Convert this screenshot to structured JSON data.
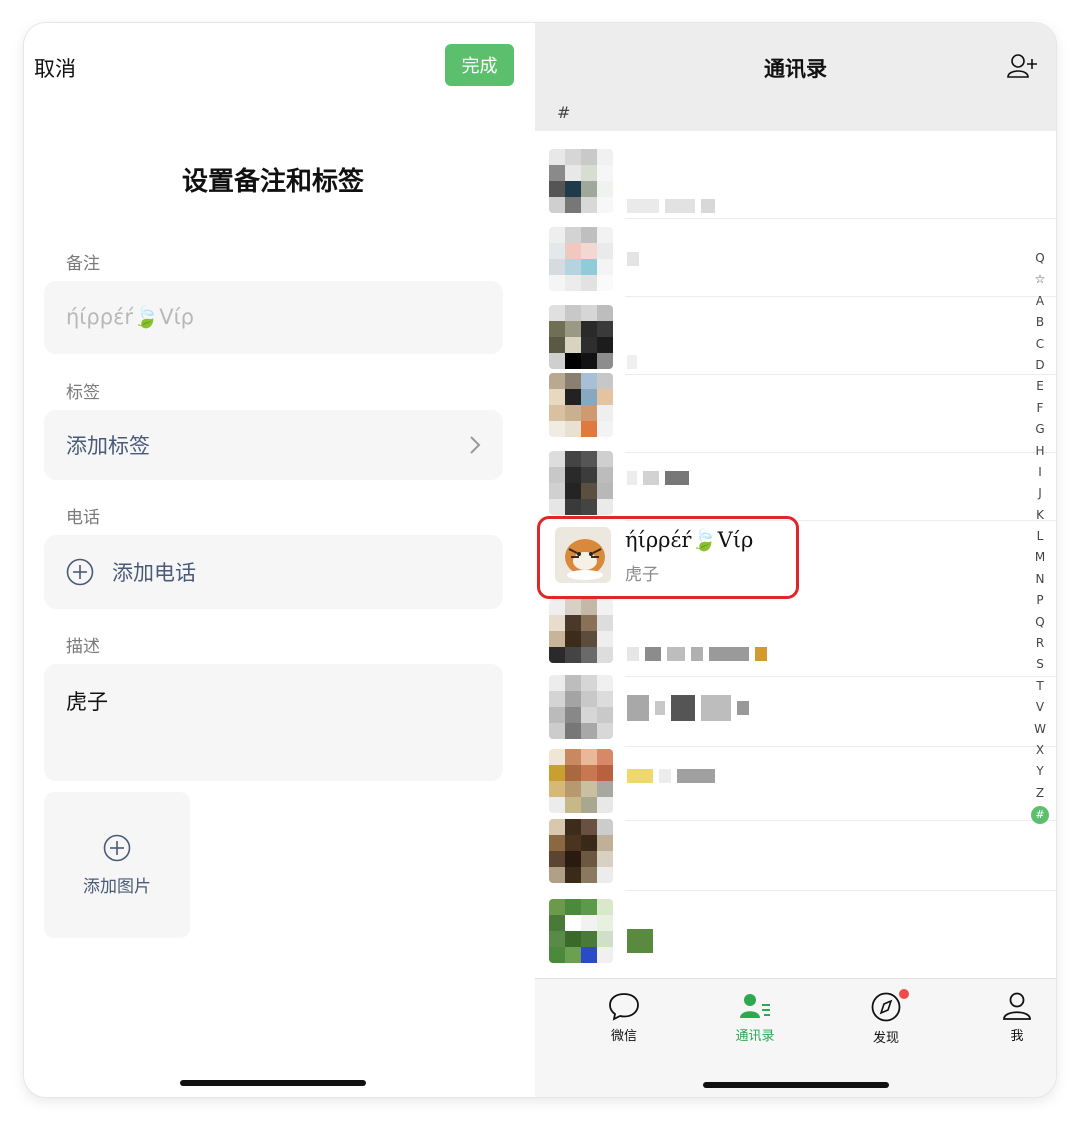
{
  "left": {
    "cancel_label": "取消",
    "done_label": "完成",
    "title": "设置备注和标签",
    "remark_label": "备注",
    "remark_placeholder": "ήίρρέŕ🍃Vίρ",
    "tag_label": "标签",
    "add_tag_label": "添加标签",
    "phone_label": "电话",
    "add_phone_label": "添加电话",
    "desc_label": "描述",
    "desc_value": "虎子",
    "add_image_label": "添加图片"
  },
  "right": {
    "title": "通讯录",
    "section_header": "#",
    "highlighted_contact": {
      "name": "ήίρρέŕ🍃Vίρ",
      "remark": "虎子"
    },
    "index_letters": [
      "Q",
      "☆",
      "A",
      "B",
      "C",
      "D",
      "E",
      "F",
      "G",
      "H",
      "I",
      "J",
      "K",
      "L",
      "M",
      "N",
      "P",
      "Q",
      "R",
      "S",
      "T",
      "V",
      "W",
      "X",
      "Y",
      "Z"
    ],
    "index_active": "#",
    "tabs": [
      {
        "label": "微信",
        "icon": "chat-icon"
      },
      {
        "label": "通讯录",
        "icon": "contacts-icon",
        "active": true
      },
      {
        "label": "发现",
        "icon": "discover-icon",
        "badge": true
      },
      {
        "label": "我",
        "icon": "me-icon"
      }
    ]
  },
  "colors": {
    "accent_green": "#5bbf6e",
    "highlight_red": "#e0262a",
    "link_blue_gray": "#4a5a78"
  }
}
